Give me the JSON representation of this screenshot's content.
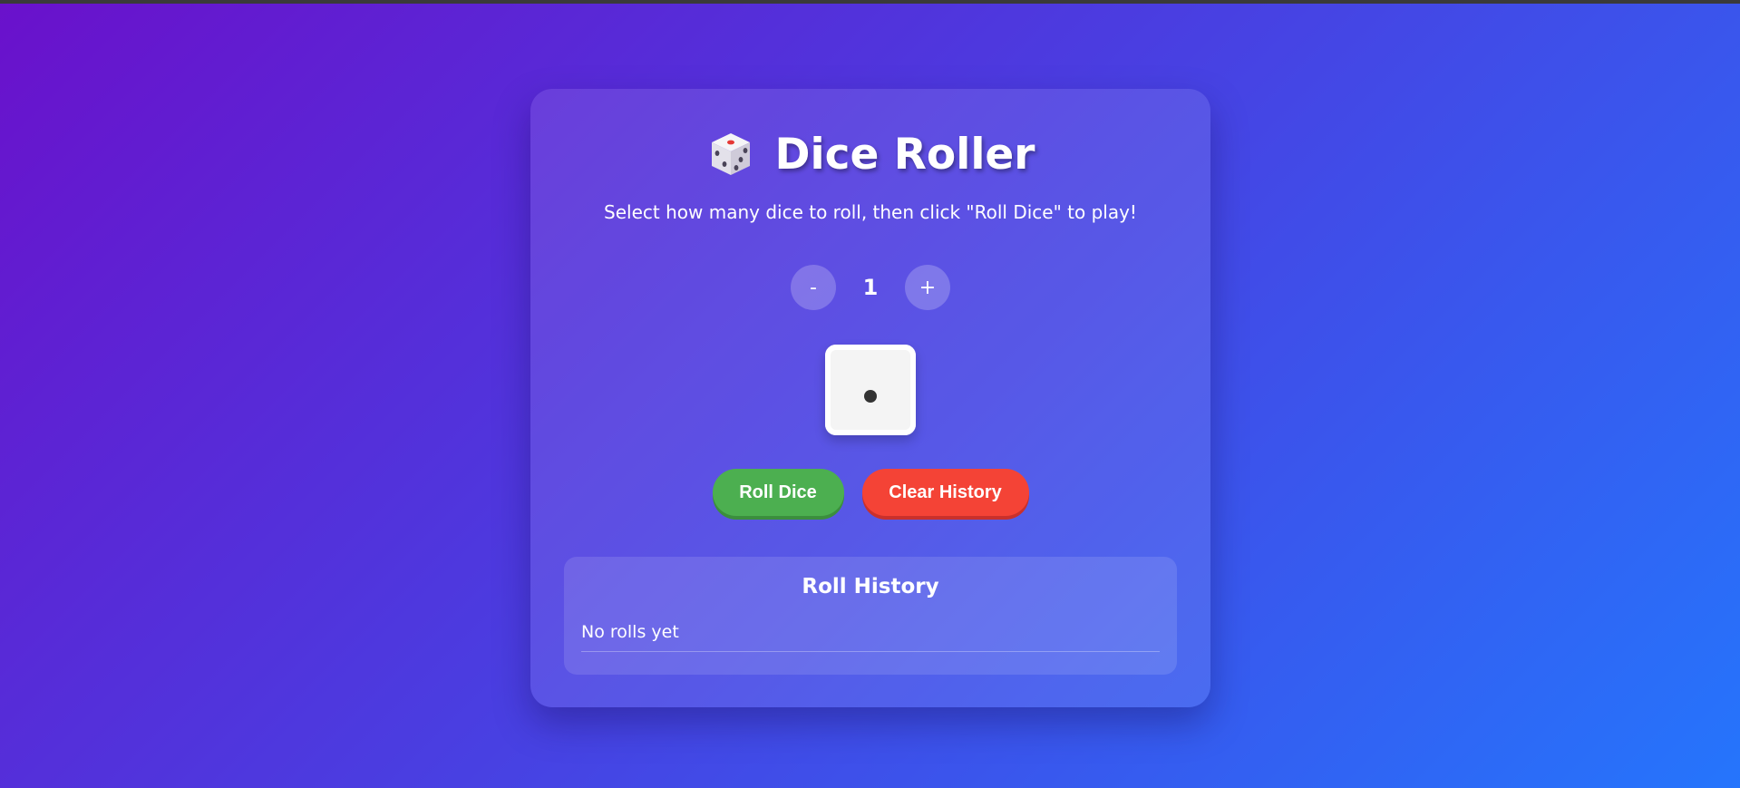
{
  "app": {
    "title": "Dice Roller",
    "title_icon": "dice-icon",
    "instructions": "Select how many dice to roll, then click \"Roll Dice\" to play!"
  },
  "dice_count": {
    "decrement_label": "-",
    "value": "1",
    "increment_label": "+"
  },
  "dice": [
    {
      "value": 1
    }
  ],
  "actions": {
    "roll_label": "Roll Dice",
    "clear_label": "Clear History"
  },
  "history": {
    "title": "Roll History",
    "empty_text": "No rolls yet"
  },
  "colors": {
    "background_start": "#6a11cb",
    "background_end": "#2575fc",
    "roll_button": "#4caf50",
    "clear_button": "#f44336",
    "die_face": "#f4f4f4",
    "pip": "#333333"
  }
}
